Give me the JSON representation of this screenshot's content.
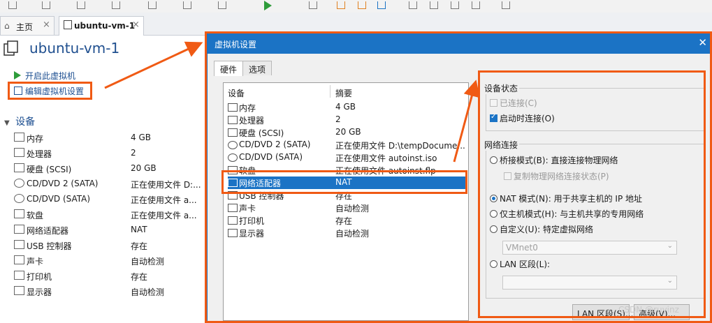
{
  "tabs": [
    {
      "label": "主页",
      "icon": "home-icon"
    },
    {
      "label": "ubuntu-vm-1",
      "icon": "vm-icon"
    }
  ],
  "vm": {
    "title": "ubuntu-vm-1",
    "actions": [
      {
        "label": "开启此虚拟机",
        "icon": "play-icon"
      },
      {
        "label": "编辑虚拟机设置",
        "icon": "edit-settings-icon"
      }
    ],
    "devices_heading": "设备",
    "devices": [
      {
        "name": "内存",
        "value": "4 GB"
      },
      {
        "name": "处理器",
        "value": "2"
      },
      {
        "name": "硬盘 (SCSI)",
        "value": "20 GB"
      },
      {
        "name": "CD/DVD 2 (SATA)",
        "value": "正在使用文件 D:..."
      },
      {
        "name": "CD/DVD (SATA)",
        "value": "正在使用文件 a..."
      },
      {
        "name": "软盘",
        "value": "正在使用文件 a..."
      },
      {
        "name": "网络适配器",
        "value": "NAT"
      },
      {
        "name": "USB 控制器",
        "value": "存在"
      },
      {
        "name": "声卡",
        "value": "自动检测"
      },
      {
        "name": "打印机",
        "value": "存在"
      },
      {
        "name": "显示器",
        "value": "自动检测"
      }
    ]
  },
  "dialog": {
    "title": "虚拟机设置",
    "tabs": [
      "硬件",
      "选项"
    ],
    "columns": {
      "device": "设备",
      "summary": "摘要"
    },
    "hardware": [
      {
        "name": "内存",
        "value": "4 GB"
      },
      {
        "name": "处理器",
        "value": "2"
      },
      {
        "name": "硬盘 (SCSI)",
        "value": "20 GB"
      },
      {
        "name": "CD/DVD 2 (SATA)",
        "value": "正在使用文件 D:\\tempDocume..."
      },
      {
        "name": "CD/DVD (SATA)",
        "value": "正在使用文件 autoinst.iso"
      },
      {
        "name": "软盘",
        "value": "正在使用文件 autoinst.flp"
      },
      {
        "name": "网络适配器",
        "value": "NAT"
      },
      {
        "name": "USB 控制器",
        "value": "存在"
      },
      {
        "name": "声卡",
        "value": "自动检测"
      },
      {
        "name": "打印机",
        "value": "存在"
      },
      {
        "name": "显示器",
        "value": "自动检测"
      }
    ],
    "selected_index": 6,
    "device_status": {
      "title": "设备状态",
      "connected": "已连接(C)",
      "connect_on_start": "启动时连接(O)"
    },
    "network": {
      "title": "网络连接",
      "bridged": "桥接模式(B): 直接连接物理网络",
      "replicate": "复制物理网络连接状态(P)",
      "nat": "NAT 模式(N): 用于共享主机的 IP 地址",
      "host_only": "仅主机模式(H): 与主机共享的专用网络",
      "custom": "自定义(U): 特定虚拟网络",
      "custom_value": "VMnet0",
      "lan": "LAN 区段(L):",
      "lan_value": ""
    },
    "buttons": {
      "lan_segments": "LAN 区段(S)...",
      "advanced": "高级(V)..."
    }
  },
  "watermark": "CSDN @ruyinz",
  "colors": {
    "accent": "#1b73c5",
    "highlight": "#f05a14",
    "title_blue": "#1f4f8f"
  }
}
